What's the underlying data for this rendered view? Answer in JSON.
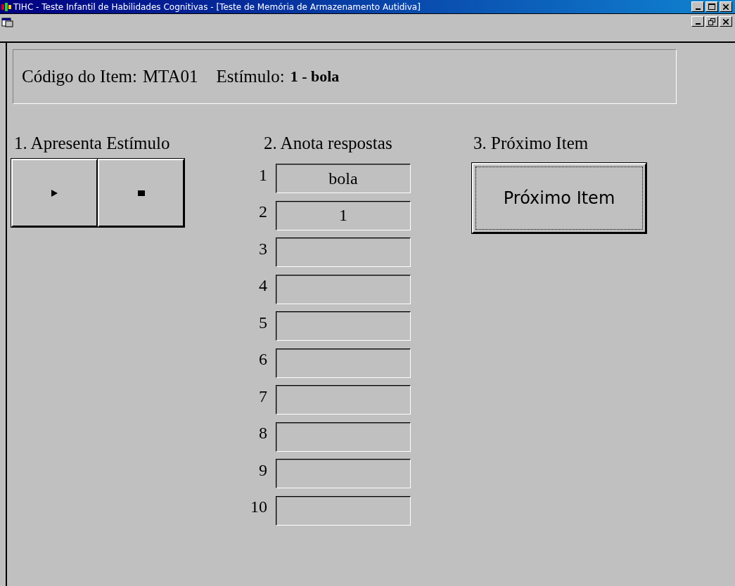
{
  "window": {
    "title": "TIHC - Teste Infantil de Habilidades Cognitivas - [Teste de Memória de Armazenamento Autidiva]"
  },
  "header": {
    "item_code_label": "Código do Item:",
    "item_code": "MTA01",
    "stimulus_label": "Estímulo:",
    "stimulus": "1 - bola"
  },
  "step1": {
    "label": "1. Apresenta Estímulo"
  },
  "step2": {
    "label": "2. Anota respostas",
    "responses": [
      {
        "number": "1",
        "value": "bola"
      },
      {
        "number": "2",
        "value": "1"
      },
      {
        "number": "3"
      },
      {
        "number": "4"
      },
      {
        "number": "5"
      },
      {
        "number": "6"
      },
      {
        "number": "7"
      },
      {
        "number": "8"
      },
      {
        "number": "9"
      },
      {
        "number": "10"
      }
    ]
  },
  "step3": {
    "label": "3. Próximo Item",
    "button": "Próximo Item"
  }
}
